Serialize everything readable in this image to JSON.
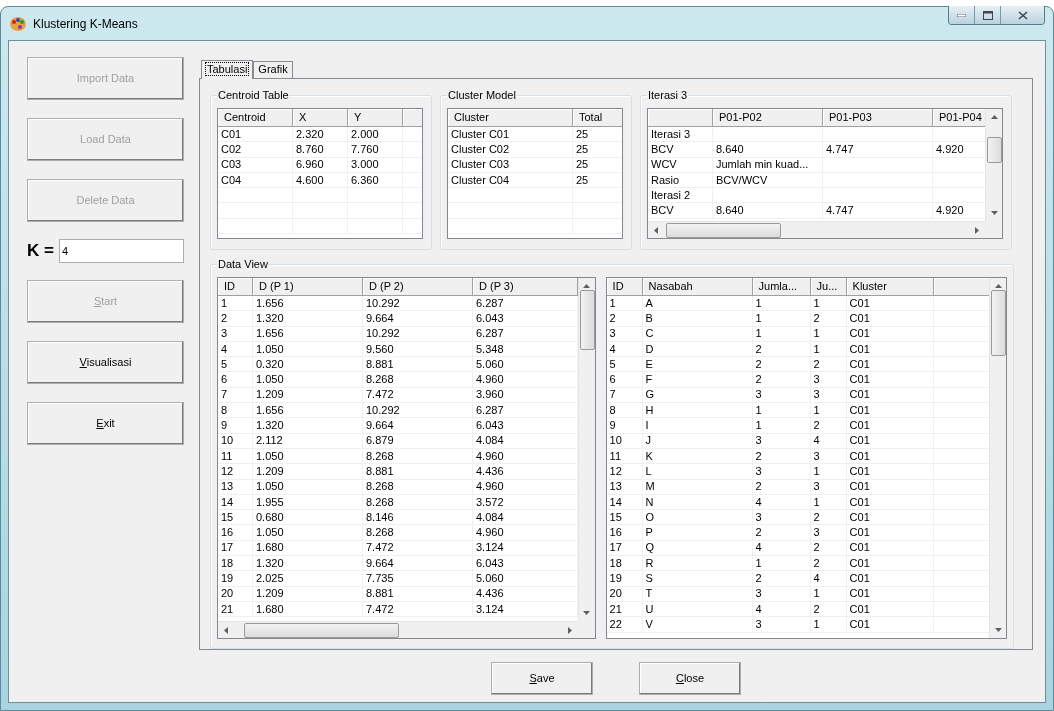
{
  "window": {
    "title": "Klustering K-Means"
  },
  "sidebar": {
    "buttons": [
      {
        "label": "Import Data",
        "disabled": true,
        "access_key_underlined": false
      },
      {
        "label": "Load Data",
        "disabled": true,
        "access_key_underlined": false
      },
      {
        "label": "Delete Data",
        "disabled": true,
        "access_key_underlined": false
      },
      {
        "label": "Start",
        "disabled": true,
        "access_key_underlined": true
      },
      {
        "label": "Visualisasi",
        "disabled": false,
        "access_key_underlined": true
      },
      {
        "label": "Exit",
        "disabled": false,
        "access_key_underlined": true
      }
    ],
    "k_field": {
      "label": "K =",
      "value": "4"
    }
  },
  "tabs": [
    {
      "label": "Tabulasi",
      "selected": true
    },
    {
      "label": "Grafik",
      "selected": false
    }
  ],
  "centroid_table": {
    "title": "Centroid Table",
    "columns": [
      "Centroid",
      "X",
      "Y"
    ],
    "rows": [
      [
        "C01",
        "2.320",
        "2.000"
      ],
      [
        "C02",
        "8.760",
        "7.760"
      ],
      [
        "C03",
        "6.960",
        "3.000"
      ],
      [
        "C04",
        "4.600",
        "6.360"
      ]
    ]
  },
  "cluster_model": {
    "title": "Cluster Model",
    "columns": [
      "Cluster",
      "Total"
    ],
    "rows": [
      [
        "Cluster C01",
        "25"
      ],
      [
        "Cluster C02",
        "25"
      ],
      [
        "Cluster C03",
        "25"
      ],
      [
        "Cluster C04",
        "25"
      ]
    ]
  },
  "iteration_table": {
    "title": "Iterasi 3",
    "columns": [
      "P01-P02",
      "P01-P03",
      "P01-P04"
    ],
    "rows": [
      {
        "label": "Iterasi 3"
      },
      {
        "label": "BCV",
        "values": [
          "8.640",
          "4.747",
          "4.920"
        ]
      },
      {
        "label": "WCV",
        "values": [
          "Jumlah min kuad..."
        ]
      },
      {
        "label": "Rasio",
        "values": [
          "BCV/WCV"
        ]
      },
      {
        "label": "Iterasi 2"
      },
      {
        "label": "BCV",
        "values": [
          "8.640",
          "4.747",
          "4.920"
        ]
      }
    ]
  },
  "data_view": {
    "title": "Data View",
    "distance_table": {
      "columns": [
        "ID",
        "D (P 1)",
        "D (P 2)",
        "D (P 3)"
      ],
      "rows": [
        [
          "1",
          "1.656",
          "10.292",
          "6.287"
        ],
        [
          "2",
          "1.320",
          "9.664",
          "6.043"
        ],
        [
          "3",
          "1.656",
          "10.292",
          "6.287"
        ],
        [
          "4",
          "1.050",
          "9.560",
          "5.348"
        ],
        [
          "5",
          "0.320",
          "8.881",
          "5.060"
        ],
        [
          "6",
          "1.050",
          "8.268",
          "4.960"
        ],
        [
          "7",
          "1.209",
          "7.472",
          "3.960"
        ],
        [
          "8",
          "1.656",
          "10.292",
          "6.287"
        ],
        [
          "9",
          "1.320",
          "9.664",
          "6.043"
        ],
        [
          "10",
          "2.112",
          "6.879",
          "4.084"
        ],
        [
          "11",
          "1.050",
          "8.268",
          "4.960"
        ],
        [
          "12",
          "1.209",
          "8.881",
          "4.436"
        ],
        [
          "13",
          "1.050",
          "8.268",
          "4.960"
        ],
        [
          "14",
          "1.955",
          "8.268",
          "3.572"
        ],
        [
          "15",
          "0.680",
          "8.146",
          "4.084"
        ],
        [
          "16",
          "1.050",
          "8.268",
          "4.960"
        ],
        [
          "17",
          "1.680",
          "7.472",
          "3.124"
        ],
        [
          "18",
          "1.320",
          "9.664",
          "6.043"
        ],
        [
          "19",
          "2.025",
          "7.735",
          "5.060"
        ],
        [
          "20",
          "1.209",
          "8.881",
          "4.436"
        ],
        [
          "21",
          "1.680",
          "7.472",
          "3.124"
        ]
      ]
    },
    "customer_table": {
      "columns": [
        "ID",
        "Nasabah",
        "Jumla...",
        "Ju...",
        "Kluster"
      ],
      "rows": [
        [
          "1",
          "A",
          "1",
          "1",
          "C01"
        ],
        [
          "2",
          "B",
          "1",
          "2",
          "C01"
        ],
        [
          "3",
          "C",
          "1",
          "1",
          "C01"
        ],
        [
          "4",
          "D",
          "2",
          "1",
          "C01"
        ],
        [
          "5",
          "E",
          "2",
          "2",
          "C01"
        ],
        [
          "6",
          "F",
          "2",
          "3",
          "C01"
        ],
        [
          "7",
          "G",
          "3",
          "3",
          "C01"
        ],
        [
          "8",
          "H",
          "1",
          "1",
          "C01"
        ],
        [
          "9",
          "I",
          "1",
          "2",
          "C01"
        ],
        [
          "10",
          "J",
          "3",
          "4",
          "C01"
        ],
        [
          "11",
          "K",
          "2",
          "3",
          "C01"
        ],
        [
          "12",
          "L",
          "3",
          "1",
          "C01"
        ],
        [
          "13",
          "M",
          "2",
          "3",
          "C01"
        ],
        [
          "14",
          "N",
          "4",
          "1",
          "C01"
        ],
        [
          "15",
          "O",
          "3",
          "2",
          "C01"
        ],
        [
          "16",
          "P",
          "2",
          "3",
          "C01"
        ],
        [
          "17",
          "Q",
          "4",
          "2",
          "C01"
        ],
        [
          "18",
          "R",
          "1",
          "2",
          "C01"
        ],
        [
          "19",
          "S",
          "2",
          "4",
          "C01"
        ],
        [
          "20",
          "T",
          "3",
          "1",
          "C01"
        ],
        [
          "21",
          "U",
          "4",
          "2",
          "C01"
        ],
        [
          "22",
          "V",
          "3",
          "1",
          "C01"
        ]
      ]
    }
  },
  "footer_buttons": [
    {
      "label": "Save",
      "access_key_underlined": true
    },
    {
      "label": "Close",
      "access_key_underlined": true
    }
  ]
}
